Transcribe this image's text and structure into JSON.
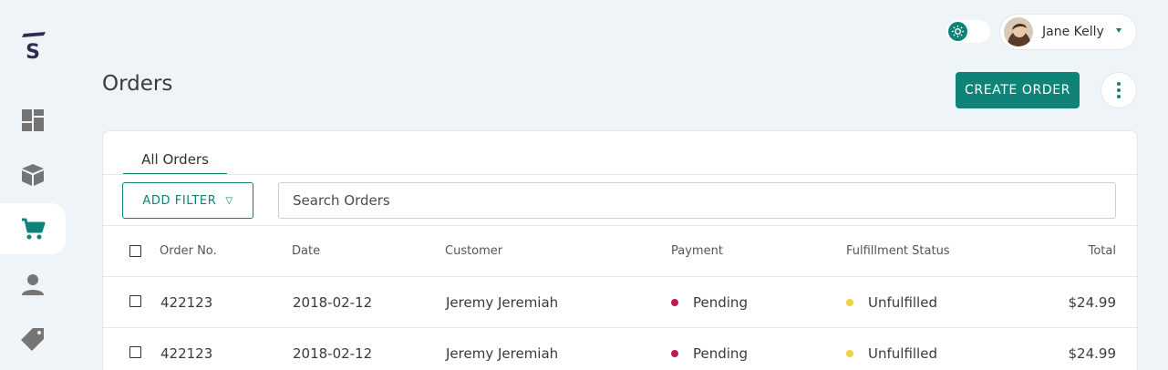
{
  "app": {
    "colors": {
      "accent": "#0f8378",
      "background": "#eff4f9",
      "pending": "#c2185b",
      "unfulfilled": "#f4d03f",
      "nav_icon": "#757575"
    },
    "logo": {
      "name": "s-logo",
      "letter": "S"
    },
    "nav": [
      {
        "name": "dashboard-icon",
        "active": false
      },
      {
        "name": "package-icon",
        "active": false
      },
      {
        "name": "cart-icon",
        "active": true
      },
      {
        "name": "user-icon",
        "active": false
      },
      {
        "name": "tag-icon",
        "active": false
      }
    ]
  },
  "header": {
    "user_name": "Jane Kelly",
    "theme_icon": "sun-icon",
    "caret_icon": "caret-down-icon"
  },
  "page": {
    "title": "Orders",
    "create_label": "CREATE ORDER",
    "more_icon": "more-vertical-icon"
  },
  "orders": {
    "tab_label": "All Orders",
    "filter_label": "ADD FILTER",
    "filter_icon": "triangle-down-icon",
    "search_placeholder": "Search Orders",
    "columns": {
      "order_no": "Order No.",
      "date": "Date",
      "customer": "Customer",
      "payment": "Payment",
      "fulfillment": "Fulfillment Status",
      "total": "Total"
    },
    "rows": [
      {
        "order_no": "422123",
        "date": "2018-02-12",
        "customer": "Jeremy Jeremiah",
        "payment": "Pending",
        "fulfillment": "Unfulfilled",
        "total": "$24.99"
      },
      {
        "order_no": "422123",
        "date": "2018-02-12",
        "customer": "Jeremy Jeremiah",
        "payment": "Pending",
        "fulfillment": "Unfulfilled",
        "total": "$24.99"
      }
    ]
  }
}
